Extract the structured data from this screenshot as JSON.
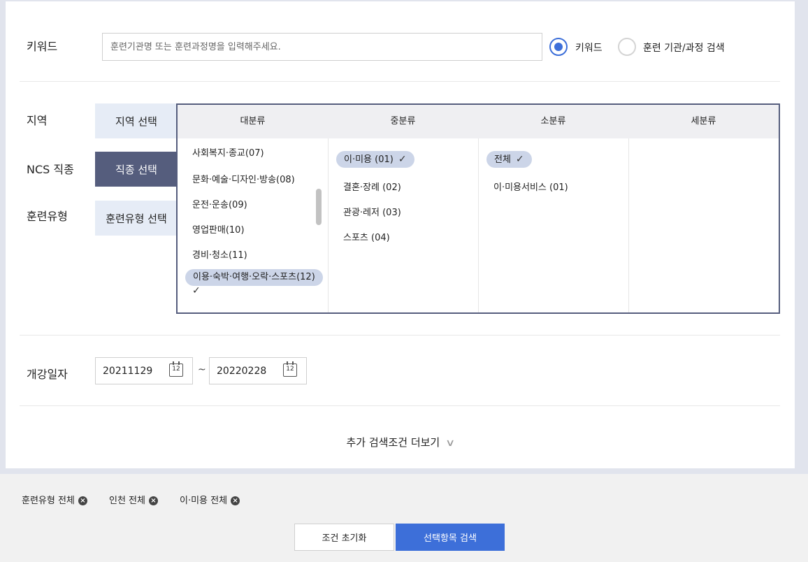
{
  "keyword": {
    "label": "키워드",
    "placeholder": "훈련기관명 또는 훈련과정명을 입력해주세요.",
    "value": "",
    "radio_options": [
      {
        "label": "키워드",
        "selected": true
      },
      {
        "label": "훈련 기관/과정 검색",
        "selected": false
      }
    ]
  },
  "filters": {
    "region": {
      "label": "지역",
      "button": "지역 선택"
    },
    "ncs": {
      "label": "NCS 직종",
      "button": "직종 선택"
    },
    "training_type": {
      "label": "훈련유형",
      "button": "훈련유형 선택"
    }
  },
  "picker": {
    "headers": [
      "대분류",
      "중분류",
      "소분류",
      "세분류"
    ],
    "major": [
      {
        "label": "사회복지·종교(07)",
        "selected": false
      },
      {
        "label": "문화·예술·디자인·방송(08)",
        "selected": false
      },
      {
        "label": "운전·운송(09)",
        "selected": false
      },
      {
        "label": "영업판매(10)",
        "selected": false
      },
      {
        "label": "경비·청소(11)",
        "selected": false
      },
      {
        "label": "이용·숙박·여행·오락·스포츠(12)",
        "selected": true
      }
    ],
    "middle": [
      {
        "label": "이·미용 (01)",
        "selected": true
      },
      {
        "label": "결혼·장례 (02)",
        "selected": false
      },
      {
        "label": "관광·레저 (03)",
        "selected": false
      },
      {
        "label": "스포츠 (04)",
        "selected": false
      }
    ],
    "minor": [
      {
        "label": "전체",
        "selected": true
      },
      {
        "label": "이·미용서비스 (01)",
        "selected": false
      }
    ],
    "detail": []
  },
  "date": {
    "label": "개강일자",
    "start": "20211129",
    "end": "20220228",
    "separator": "~",
    "calendar_icon_text": "12"
  },
  "more_conditions": "추가 검색조건 더보기",
  "chips": [
    {
      "label": "훈련유형 전체"
    },
    {
      "label": "인천 전체"
    },
    {
      "label": "이·미용 전체"
    }
  ],
  "buttons": {
    "reset": "조건 초기화",
    "search": "선택항목 검색"
  },
  "colors": {
    "accent": "#3d6fd9",
    "tab_dark": "#555d7d",
    "tab_light": "#e6ecf6",
    "pill": "#ccd5e8"
  }
}
